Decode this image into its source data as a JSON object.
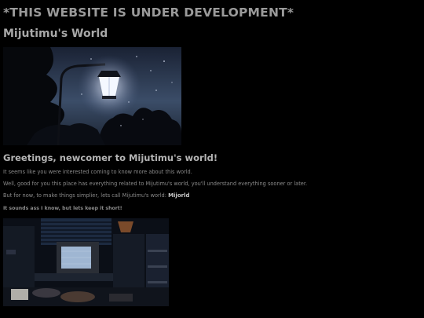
{
  "banner": "*THIS WEBSITE IS UNDER DEVELOPMENT*",
  "site_title": "Mijutimu's World",
  "greeting": "Greetings, newcomer to Mijutimu's world!",
  "paragraphs": {
    "p1": "It seems like you were interested coming to know more about this world.",
    "p2": "Well, good for you this place has everything related to Mijutimu's world, you'll understand everything sooner or later.",
    "p3_prefix": "But for now, to make things simplier, lets call Mijutimu's world: ",
    "p3_highlight": "Mijorld"
  },
  "note": "It sounds ass I know, but lets keep it short!",
  "colors": {
    "background": "#000000",
    "heading": "#a8a8a8",
    "body_text": "#8a8a8a"
  }
}
